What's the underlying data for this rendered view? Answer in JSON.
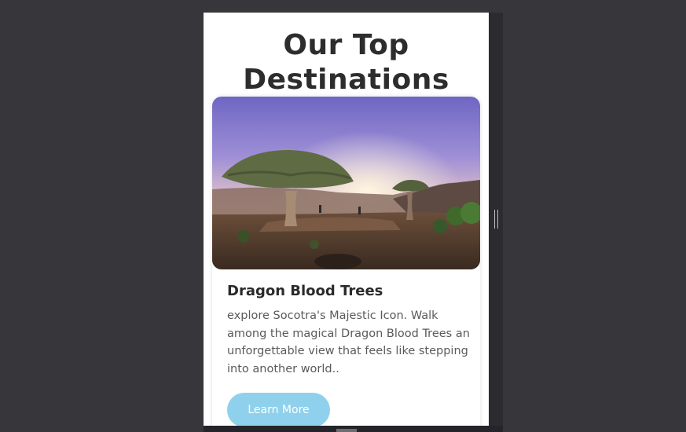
{
  "page": {
    "title_line1": "Our Top",
    "title_line2": "Destinations"
  },
  "card": {
    "image_alt": "Dragon blood trees on a hilltop at sunset",
    "title": "Dragon Blood Trees",
    "description": "explore Socotra's Majestic Icon. Walk among the magical Dragon Blood Trees an unforgettable view that feels like stepping into another world..",
    "button_label": "Learn More"
  },
  "colors": {
    "background": "#37363b",
    "page": "#ffffff",
    "button": "#8fd1ec",
    "title_text": "#2d2d2d"
  }
}
